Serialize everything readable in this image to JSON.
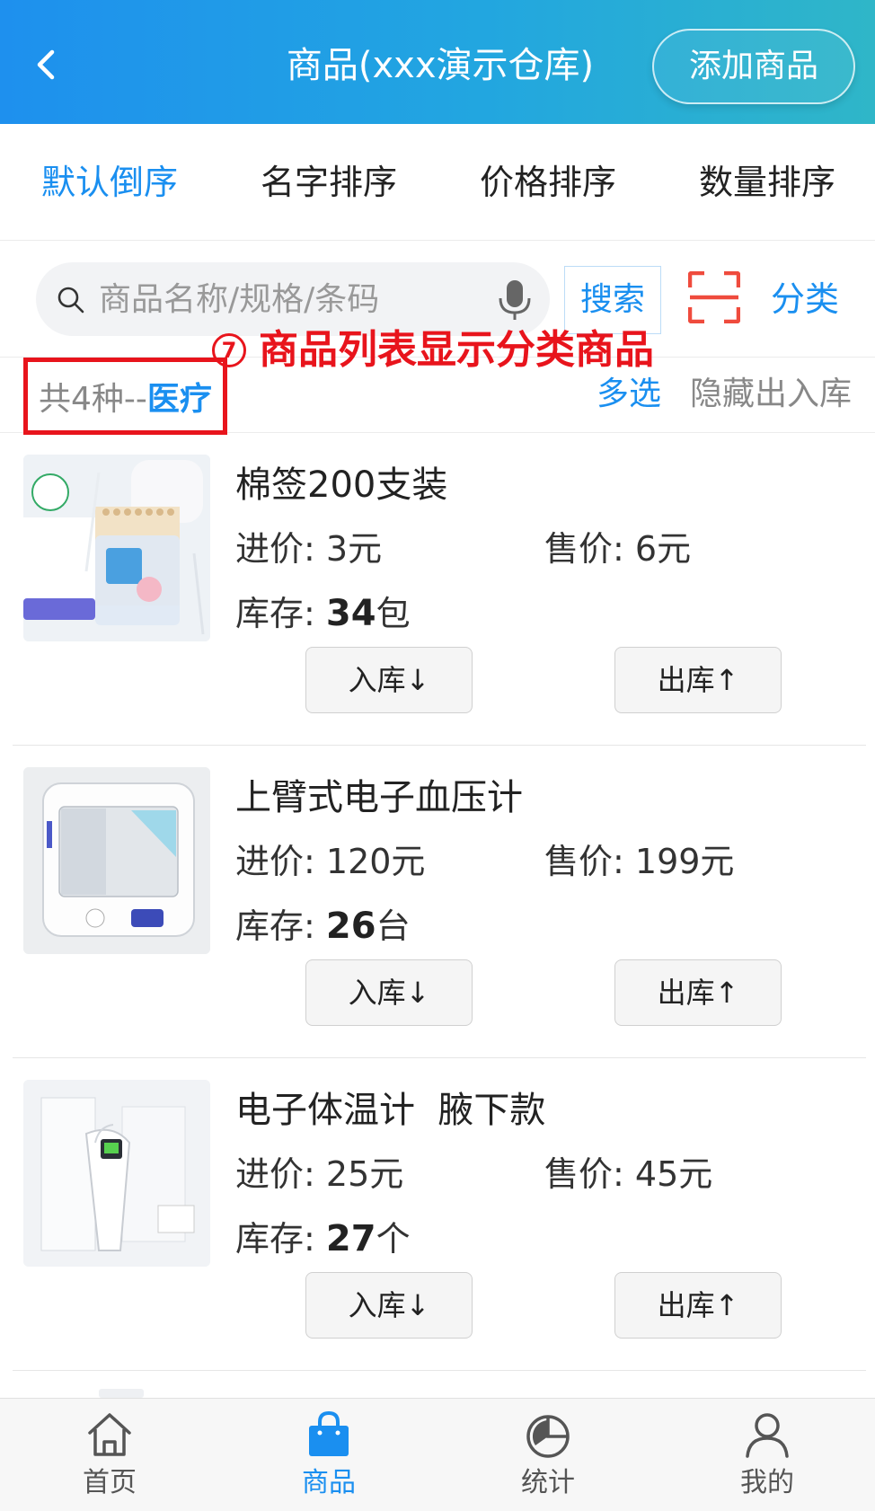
{
  "header": {
    "title": "商品(xxx演示仓库)",
    "add_button": "添加商品"
  },
  "sort_tabs": [
    "默认倒序",
    "名字排序",
    "价格排序",
    "数量排序"
  ],
  "search": {
    "placeholder": "商品名称/规格/条码",
    "button": "搜索",
    "category": "分类"
  },
  "annotation": {
    "number": "7",
    "text": "商品列表显示分类商品"
  },
  "filter": {
    "count_text": "共4种--",
    "category": "医疗",
    "multi_select": "多选",
    "hide_inout": "隐藏出入库"
  },
  "labels": {
    "buy_price": "进价:",
    "sell_price": "售价:",
    "stock": "库存:",
    "in_button": "入库↓",
    "out_button": "出库↑"
  },
  "products": [
    {
      "name": "棉签200支装",
      "buy": "3元",
      "sell": "6元",
      "stock_num": "34",
      "stock_unit": "包"
    },
    {
      "name": "上臂式电子血压计",
      "buy": "120元",
      "sell": "199元",
      "stock_num": "26",
      "stock_unit": "台"
    },
    {
      "name": "电子体温计  腋下款",
      "buy": "25元",
      "sell": "45元",
      "stock_num": "27",
      "stock_unit": "个"
    }
  ],
  "bottom_nav": [
    {
      "label": "首页",
      "icon": "home-icon"
    },
    {
      "label": "商品",
      "icon": "shopping-bag-icon",
      "active": true
    },
    {
      "label": "统计",
      "icon": "pie-chart-icon"
    },
    {
      "label": "我的",
      "icon": "user-icon"
    }
  ],
  "colors": {
    "accent": "#1a8ff0",
    "annotation": "#e8141c"
  }
}
